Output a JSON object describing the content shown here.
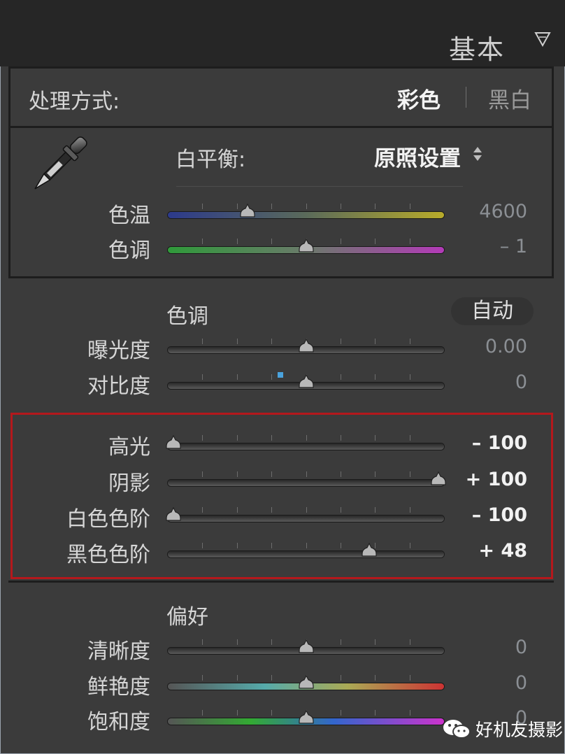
{
  "panel": {
    "title": "基本"
  },
  "treatment": {
    "label": "处理方式:",
    "color_option": "彩色",
    "bw_option": "黑白"
  },
  "white_balance": {
    "label": "白平衡:",
    "preset": "原照设置",
    "sliders": [
      {
        "id": "temp",
        "label": "色温",
        "value_text": "4600",
        "position": 0.28,
        "track": "temp"
      },
      {
        "id": "tint",
        "label": "色调",
        "value_text": "– 1",
        "position": 0.5,
        "track": "tint"
      }
    ]
  },
  "tone": {
    "heading": "色调",
    "auto_label": "自动",
    "sliders": [
      {
        "id": "exposure",
        "label": "曝光度",
        "value_text": "0.00",
        "position": 0.5
      },
      {
        "id": "contrast",
        "label": "对比度",
        "value_text": "0",
        "position": 0.5
      },
      {
        "id": "highlights",
        "label": "高光",
        "value_text": "– 100",
        "position": 0.0
      },
      {
        "id": "shadows",
        "label": "阴影",
        "value_text": "+ 100",
        "position": 1.0
      },
      {
        "id": "whites",
        "label": "白色色阶",
        "value_text": "– 100",
        "position": 0.0
      },
      {
        "id": "blacks",
        "label": "黑色色阶",
        "value_text": "+ 48",
        "position": 0.74
      }
    ]
  },
  "presence": {
    "heading": "偏好",
    "sliders": [
      {
        "id": "clarity",
        "label": "清晰度",
        "value_text": "0",
        "position": 0.5
      },
      {
        "id": "vibrance",
        "label": "鲜艳度",
        "value_text": "0",
        "position": 0.5
      },
      {
        "id": "saturation",
        "label": "饱和度",
        "value_text": "0",
        "position": 0.5
      }
    ]
  },
  "watermark": {
    "text": "好机友摄影"
  },
  "colors": {
    "highlight_border": "#b4181c",
    "bg": "#3b3b3b"
  }
}
